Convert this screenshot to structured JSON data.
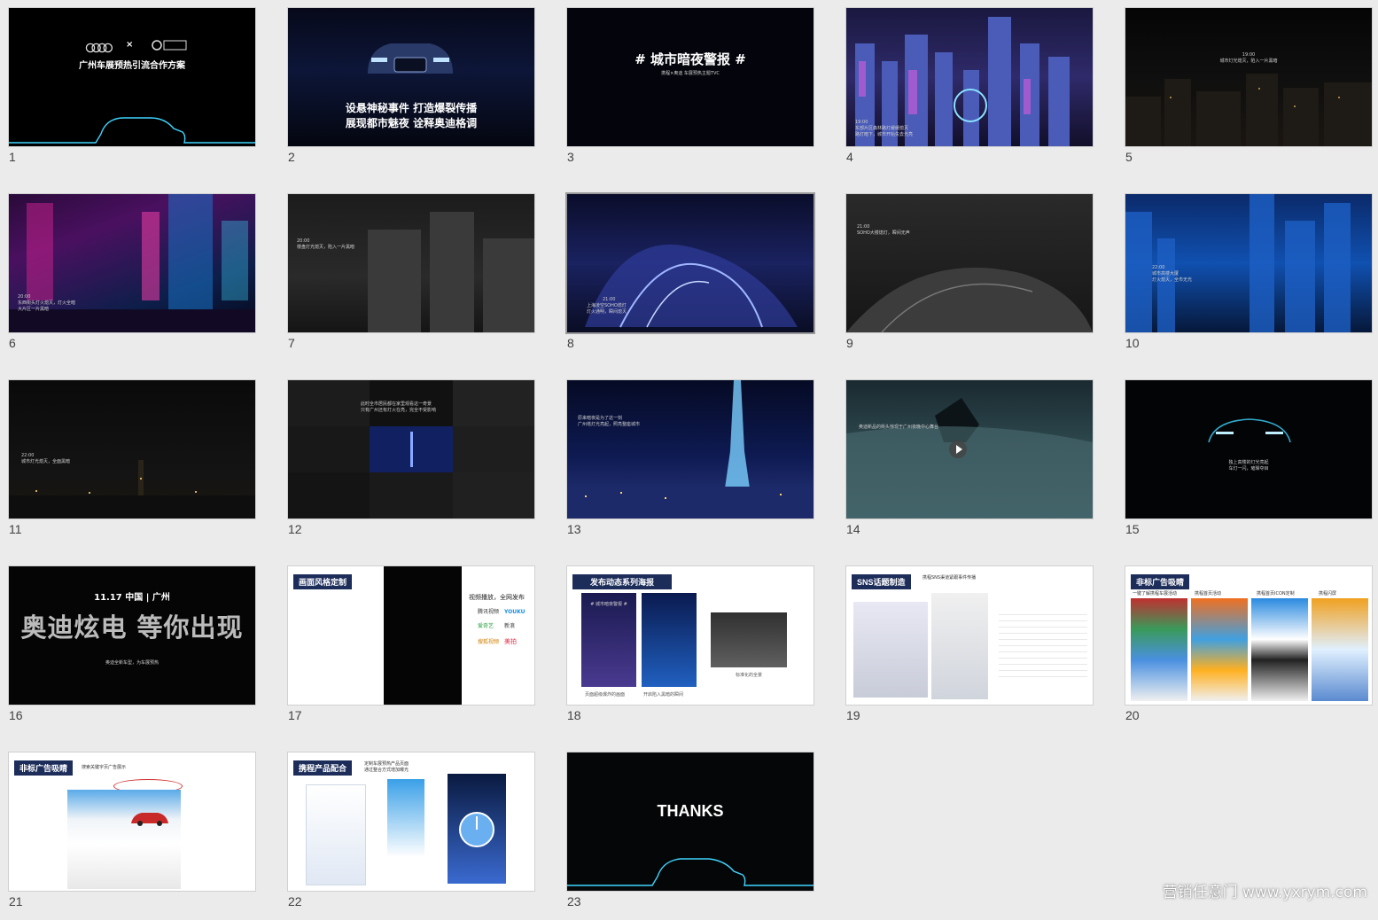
{
  "slides": [
    {
      "num": "1",
      "title": "广州车展预热引流合作方案",
      "sub": "×"
    },
    {
      "num": "2",
      "line1": "设悬神秘事件  打造爆裂传播",
      "line2": "展现都市魅夜  诠释奥迪格调"
    },
    {
      "num": "3",
      "title": "# 城市暗夜警报 #",
      "sub": "携程×奥迪  车展预热主题TVC"
    },
    {
      "num": "4",
      "time": "19:00",
      "caption": "东部片区森林路灯缓缓熄灭",
      "caption2": "路灯暗下，城市开始失去光亮"
    },
    {
      "num": "5",
      "time": "19:00",
      "caption": "城市灯光熄灭，陷入一片黑暗"
    },
    {
      "num": "6",
      "time": "20:00",
      "caption": "东西街头灯火熄灭，灯火全暗",
      "caption2": "大片区一片黑暗"
    },
    {
      "num": "7",
      "time": "20:00",
      "caption": "楼盘灯光熄灭，陷入一片黑暗"
    },
    {
      "num": "8",
      "time": "21:00",
      "caption": "上海凌空SOHO熄灯",
      "caption2": "灯火通明，瞬间熄灭"
    },
    {
      "num": "9",
      "time": "21:00",
      "caption": "SOHO大楼熄灯，瞬间无声"
    },
    {
      "num": "10",
      "time": "22:00",
      "caption": "城市高楼大厦",
      "caption2": "灯火熄灭，全市无光"
    },
    {
      "num": "11",
      "time": "22:00",
      "caption": "城市灯光熄灭，全面黑暗"
    },
    {
      "num": "12",
      "caption": "此时全市居民都在家里观看这一奇景",
      "caption2": "只有广州还有灯火在亮，完全不受影响"
    },
    {
      "num": "13",
      "caption": "原来暗夜是为了这一刻",
      "caption2": "广州塔灯光亮起，照亮整座城市"
    },
    {
      "num": "14",
      "caption": "奥迪新品的街头惊现于广州夜晚中心舞台"
    },
    {
      "num": "15",
      "caption": "独上高楼的灯光亮起",
      "caption2": "车灯一闪，璀璨夺目"
    },
    {
      "num": "16",
      "date": "11.17  中国 | 广州",
      "big": "奥迪炫电  等你出现",
      "caption": "奥迪全新车型，为车展预热"
    },
    {
      "num": "17",
      "tag": "画面风格定制",
      "side": "视频播放，全网发布",
      "logo1": "腾讯视频",
      "logo2": "YOUKU",
      "logo3": "爱奇艺",
      "logo4": "新浪",
      "logo5": "美拍",
      "logo6": "搜狐视频"
    },
    {
      "num": "18",
      "tag": "发布动态系列海报",
      "poster": "# 城市暗夜警报 #",
      "cap1": "页面超级爆炸的画面",
      "cap2": "开启陷入黑暗的瞬间",
      "cap3": "标准化的全景"
    },
    {
      "num": "19",
      "tag": "SNS话题制造",
      "head": "携程SNS渠道紧跟事件传播"
    },
    {
      "num": "20",
      "tag": "非标广告吸睛",
      "col1": "一键了解携程车展活动",
      "col2": "携程首页活动",
      "col3": "携程首页ICON定制",
      "col4": "携程闪屏"
    },
    {
      "num": "21",
      "tag": "非标广告吸睛",
      "head": "搜索关键字页广告展示"
    },
    {
      "num": "22",
      "tag": "携程产品配合",
      "head": "定制车展预热产品页面",
      "head2": "通过整合方式增加曝光"
    },
    {
      "num": "23",
      "title": "THANKS"
    }
  ],
  "watermark": "营销任意门 www.yxrym.com",
  "colors": {
    "bg": "#ebebeb",
    "navy": "#1c2d5a",
    "neon": "#3fd6ff"
  }
}
